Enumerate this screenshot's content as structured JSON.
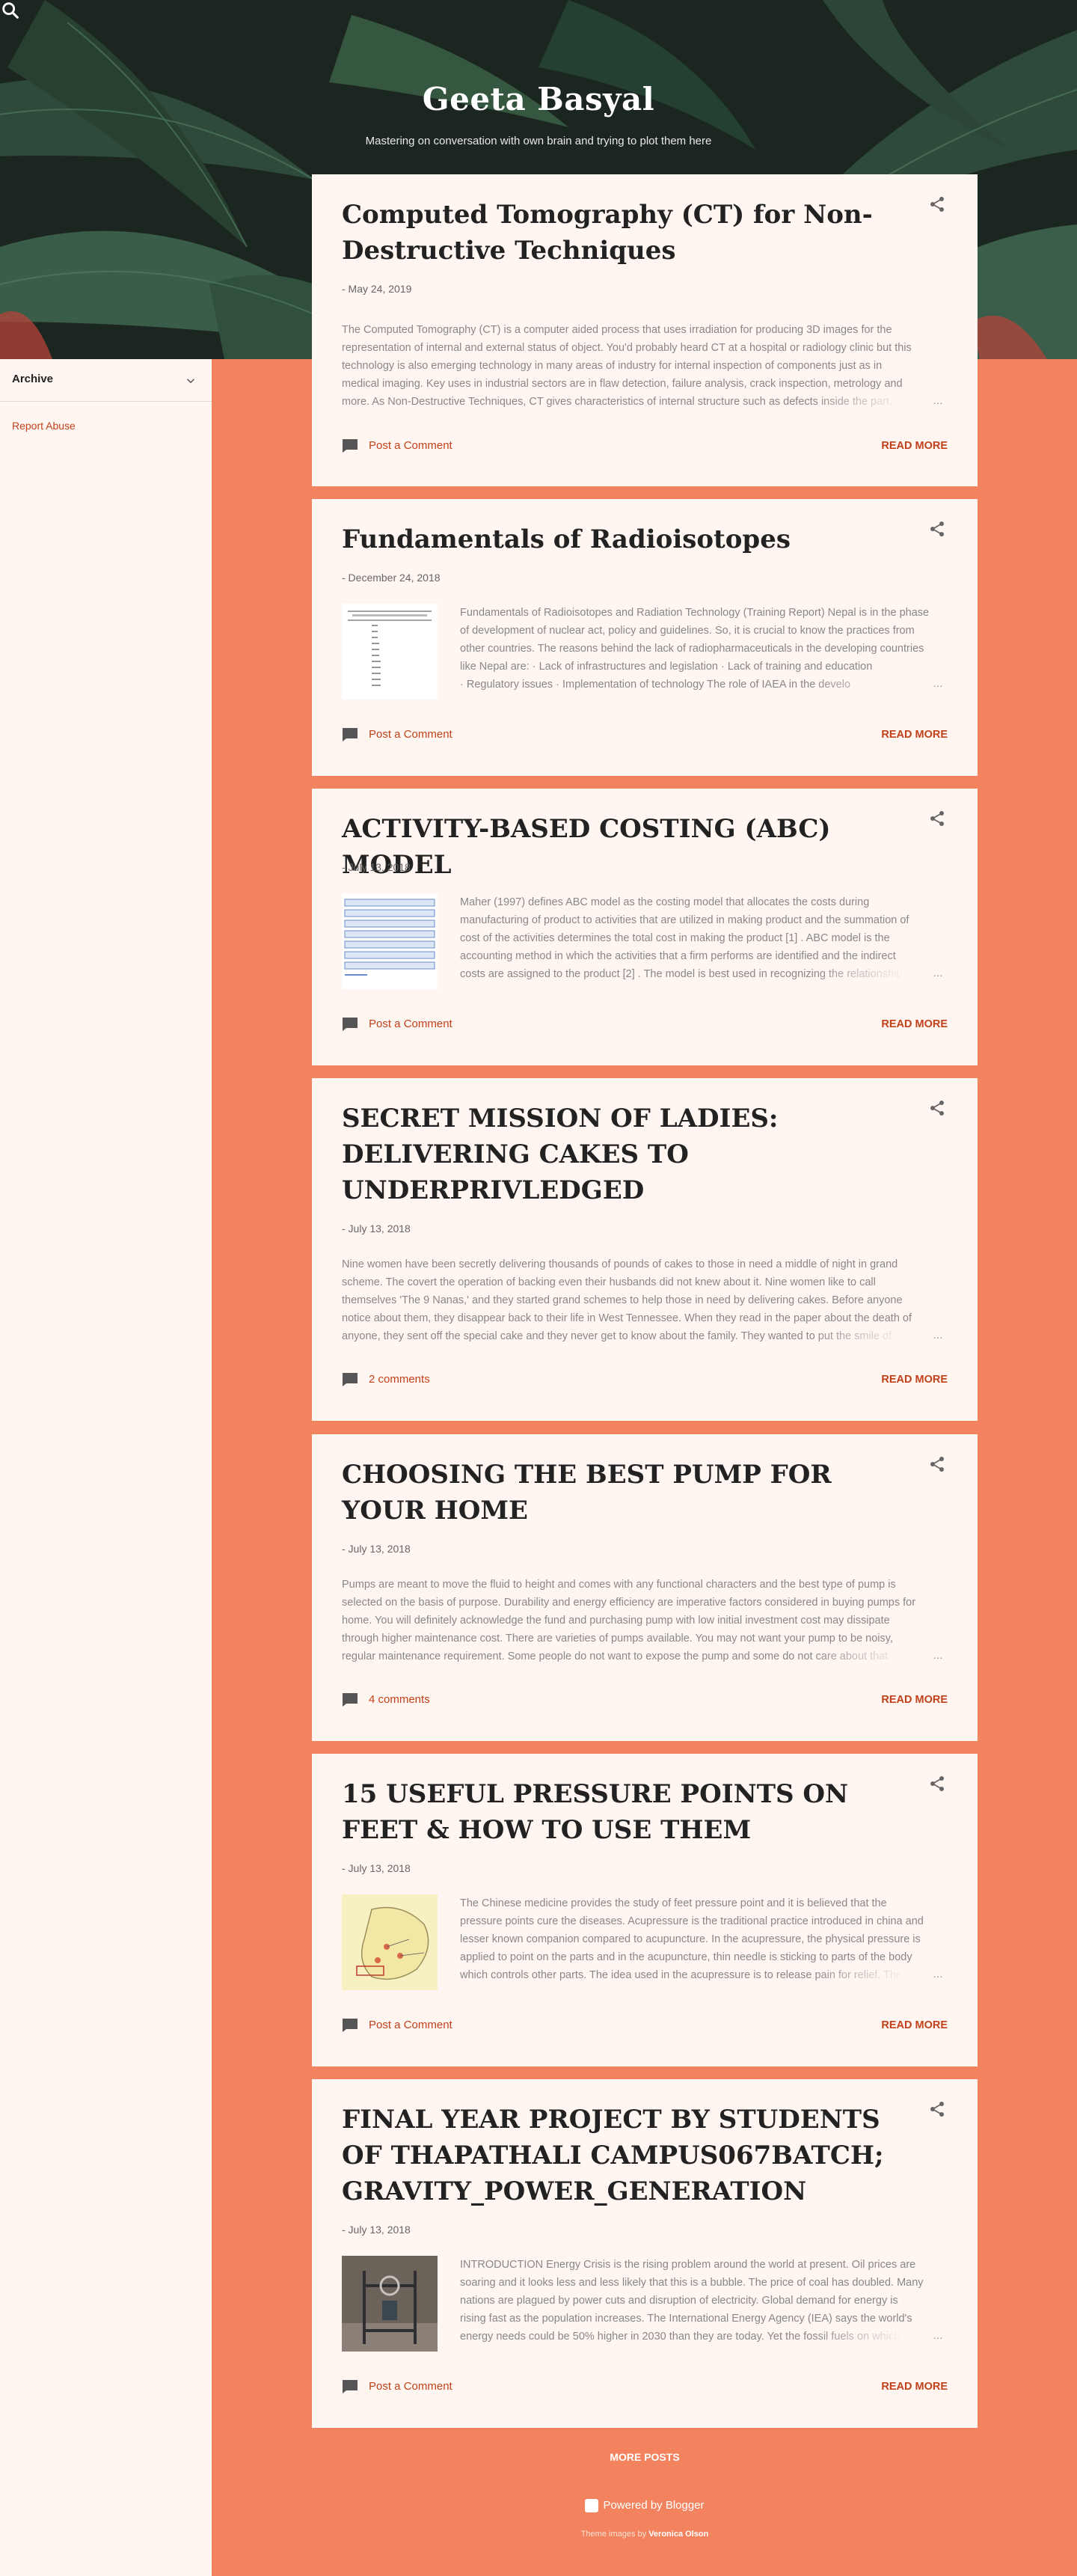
{
  "blog": {
    "title": "Geeta Basyal",
    "description": "Mastering on conversation with own brain and trying to plot them here"
  },
  "sidebar": {
    "archive_label": "Archive",
    "report_abuse": "Report Abuse"
  },
  "posts": [
    {
      "title": "Computed Tomography (CT) for Non-Destructive Techniques",
      "date": "- May 24, 2019",
      "excerpt": [
        "The Computed Tomography (CT) is a computer aided process that uses irradiation for producing 3D images for the",
        "representation of internal and external status of object. You'd probably heard CT at a hospital or radiology clinic but this",
        "technology is also emerging technology in many areas of industry for internal inspection of components just as in",
        "medical imaging. Key uses in industrial sectors are in flaw detection, failure analysis, crack inspection, metrology and",
        "more. As Non-Destructive Techniques, CT gives characteristics of internal structure such as defects inside the part,"
      ],
      "comments": "Post a Comment",
      "read_more": "READ MORE"
    },
    {
      "title": "Fundamentals of Radioisotopes",
      "date": "- December 24, 2018",
      "excerpt": [
        "Fundamentals of Radioisotopes and Radiation Technology (Training Report) Nepal is in the phase",
        "of development of nuclear act, policy and guidelines.   So, it is crucial to know the practices from",
        "other countries. The reasons behind the lack of radiopharmaceuticals in the developing countries",
        "like Nepal are: ·           Lack of infrastructures and legislation ·           Lack of training and education",
        "·           Regulatory issues ·           Implementation of technology The role of IAEA  in the develo"
      ],
      "comments": "Post a Comment",
      "read_more": "READ MORE"
    },
    {
      "title": "ACTIVITY-BASED COSTING (ABC) MODEL",
      "date": "- July 13, 2018",
      "excerpt": [
        "Maher (1997) defines ABC model as the costing model that allocates the costs during",
        "manufacturing of product to activities that are utilized in making product and the summation of",
        "cost of the activities determines the total cost in making the product [1] . ABC model is the",
        "accounting method in which the activities that a firm performs are identified and the indirect",
        "costs are assigned to the product [2] . The model is best used in recognizing the relationship"
      ],
      "comments": "Post a Comment",
      "read_more": "READ MORE"
    },
    {
      "title": "SECRET MISSION OF LADIES: DELIVERING CAKES TO UNDERPRIVLEDGED",
      "date": "- July 13, 2018",
      "excerpt": [
        "Nine women have been secretly delivering thousands of pounds of cakes to those in need a middle of night in grand",
        "scheme. The covert the operation of backing even their husbands did not knew about it. Nine women like to call",
        "themselves 'The 9 Nanas,' and they started grand schemes to help those in need by delivering cakes. Before anyone",
        "notice about them, they disappear back to their life in West Tennessee. When they read in the paper about the death of",
        "anyone, they sent off the special cake and they never get to know about the family. They wanted to put the smile of"
      ],
      "comments": "2 comments",
      "read_more": "READ MORE"
    },
    {
      "title": "CHOOSING THE BEST PUMP FOR YOUR HOME",
      "date": "- July 13, 2018",
      "excerpt": [
        "Pumps are meant to move the fluid to height and comes with any functional characters and the best type of pump is",
        "selected on the basis of purpose. Durability and energy efficiency are imperative factors considered in buying pumps for",
        "home. You will definitely acknowledge the fund and purchasing pump with low initial investment cost may dissipate",
        "through higher maintenance cost. There are varieties of pumps available. You may not want your pump to be noisy,",
        "regular maintenance requirement. Some people do not want to expose the pump and some do not care about that"
      ],
      "comments": "4 comments",
      "read_more": "READ MORE"
    },
    {
      "title": "15 USEFUL PRESSURE POINTS ON FEET & HOW TO USE THEM",
      "date": "- July 13, 2018",
      "excerpt": [
        "The Chinese medicine provides the study of feet pressure point and it is believed that the",
        "pressure points cure the diseases. Acupressure is the traditional practice introduced in china and",
        "lesser known companion compared to acupuncture. In the acupressure, the physical pressure is",
        "applied to point on the parts and in the acupuncture, thin needle is sticking to parts of the body",
        "which controls other parts. The idea used in the acupressure is to release pain for relief. The"
      ],
      "comments": "Post a Comment",
      "read_more": "READ MORE"
    },
    {
      "title": "FINAL YEAR PROJECT BY STUDENTS OF THAPATHALI CAMPUS067BATCH; GRAVITY_POWER_GENERATION",
      "date": "- July 13, 2018",
      "excerpt": [
        "INTRODUCTION Energy Crisis is the rising problem around the world at present. Oil prices are",
        "soaring and it looks less and less likely that this is a bubble. The price of coal has doubled. Many",
        "nations are plagued by power cuts and disruption of electricity.  Global demand for energy is",
        "rising fast as the population increases. The International Energy Agency (IEA) says the world's",
        "energy needs could be 50% higher in 2030 than they are today. Yet the fossil fuels on which the"
      ],
      "comments": "Post a Comment",
      "read_more": "READ MORE"
    }
  ],
  "footer": {
    "more_posts": "MORE POSTS",
    "powered_by": "Powered by Blogger",
    "theme_prefix": "Theme images by",
    "theme_author": "Veronica Olson"
  },
  "colors": {
    "accent": "#c1411a",
    "background": "#f2835e",
    "card": "#fff6f2"
  },
  "icons": [
    "search-icon",
    "share-icon",
    "comment-icon",
    "chevron-down-icon",
    "blogger-icon"
  ]
}
